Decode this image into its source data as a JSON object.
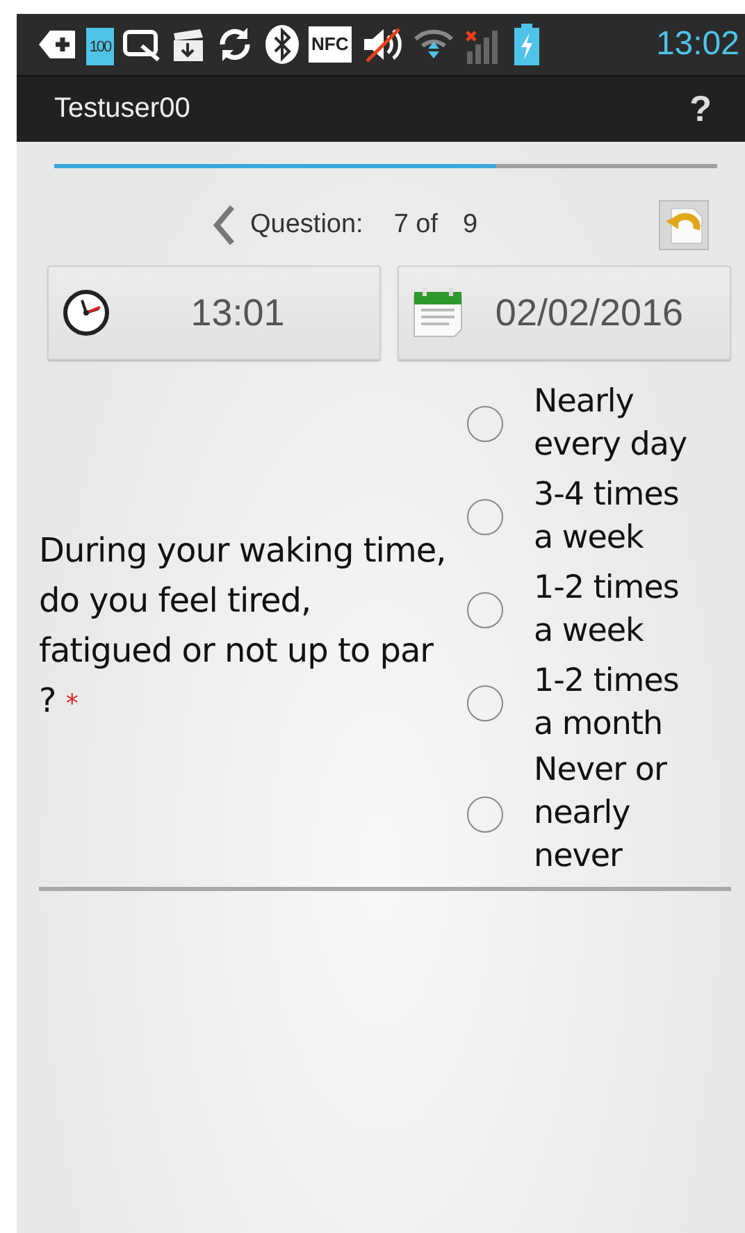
{
  "status_bar": {
    "icons": [
      {
        "kind": "plus-tag"
      },
      {
        "kind": "battery-saver",
        "label": "100"
      },
      {
        "kind": "screen-capture"
      },
      {
        "kind": "download-box"
      },
      {
        "kind": "sync"
      },
      {
        "kind": "bluetooth"
      },
      {
        "kind": "nfc",
        "label": "NFC"
      },
      {
        "kind": "sound-muted"
      },
      {
        "kind": "wifi"
      },
      {
        "kind": "signal-none"
      },
      {
        "kind": "battery-charging"
      }
    ],
    "time": "13:02"
  },
  "app_bar": {
    "title": "Testuser00",
    "help": "?"
  },
  "progress": {
    "level": 0.667
  },
  "navigation": {
    "label": "Question:",
    "current": "7 of",
    "total": "9"
  },
  "time_button": {
    "value": "13:01"
  },
  "date_button": {
    "value": "02/02/2016"
  },
  "question": {
    "text": "During your waking time, do you feel tired, fatigued or not up to par ?",
    "required_mark": "*",
    "options": [
      {
        "label": "Nearly every day",
        "selected": false
      },
      {
        "label": "3-4 times a week",
        "selected": false
      },
      {
        "label": "1-2 times a week",
        "selected": false
      },
      {
        "label": "1-2 times a month",
        "selected": false
      },
      {
        "label": "Never or nearly never",
        "selected": false
      }
    ]
  }
}
